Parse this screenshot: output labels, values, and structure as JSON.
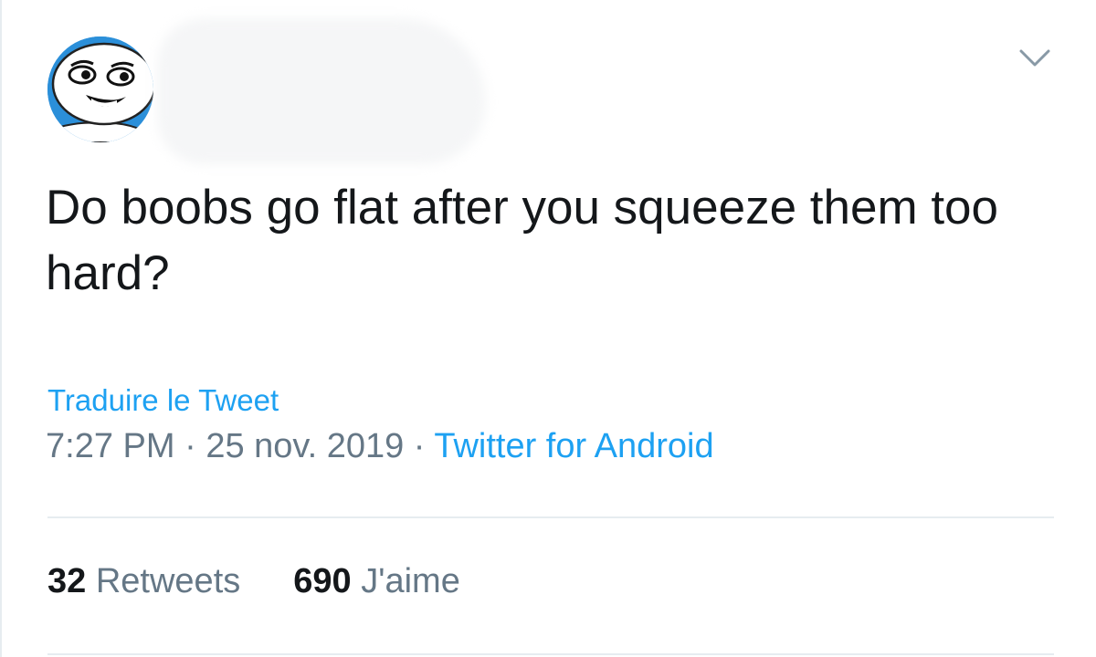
{
  "tweet": {
    "text": "Do boobs go flat after you squeeze them too hard?",
    "translate_label": "Traduire le Tweet",
    "time": "7:27 PM",
    "separator": " · ",
    "date": "25 nov. 2019",
    "source": "Twitter for Android"
  },
  "stats": {
    "retweets_count": "32",
    "retweets_label": "Retweets",
    "likes_count": "690",
    "likes_label": "J'aime"
  },
  "icons": {
    "avatar": "meme-face-avatar",
    "menu": "chevron-down-icon"
  },
  "colors": {
    "accent": "#1da1f2",
    "text": "#14171a",
    "secondary": "#657786",
    "avatar_bg": "#2b8fd9"
  }
}
